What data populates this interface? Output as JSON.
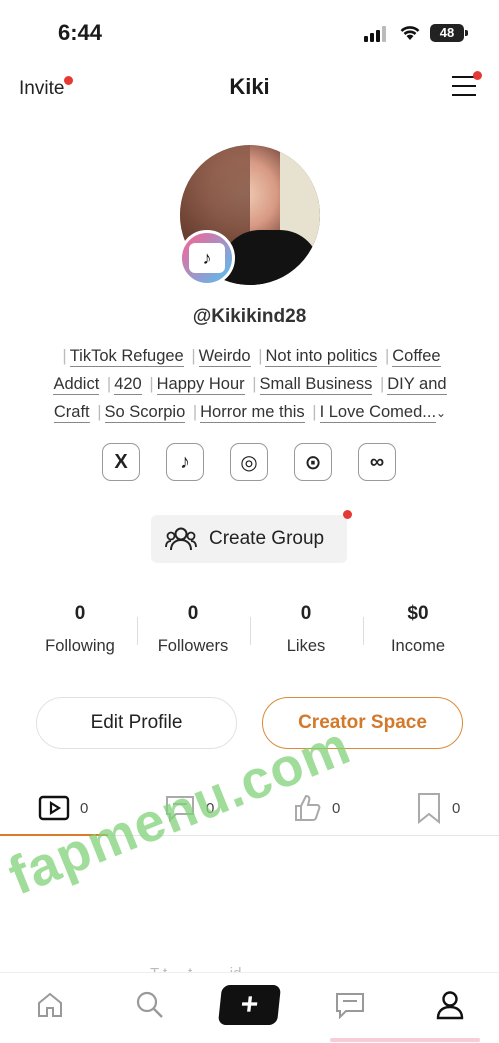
{
  "status_bar": {
    "time": "6:44",
    "battery": "48"
  },
  "header": {
    "invite_label": "Invite",
    "title": "Kiki"
  },
  "profile": {
    "handle": "@Kikikind28",
    "tags": [
      "TikTok Refugee",
      "Weirdo",
      "Not into politics",
      "Coffee Addict",
      "420",
      "Happy Hour",
      "Small Business",
      "DIY and Craft",
      "So Scorpio",
      "Horror me this",
      "I Love Comed..."
    ]
  },
  "socials": [
    {
      "icon": "x-icon",
      "glyph": "X"
    },
    {
      "icon": "tiktok-icon",
      "glyph": "♪"
    },
    {
      "icon": "instagram-icon",
      "glyph": "◎"
    },
    {
      "icon": "onlyfans-icon",
      "glyph": "⊙"
    },
    {
      "icon": "link-icon",
      "glyph": "∞"
    }
  ],
  "create_group": {
    "label": "Create Group"
  },
  "stats": [
    {
      "value": "0",
      "label": "Following"
    },
    {
      "value": "0",
      "label": "Followers"
    },
    {
      "value": "0",
      "label": "Likes"
    },
    {
      "value": "$0",
      "label": "Income"
    }
  ],
  "buttons": {
    "edit_profile": "Edit Profile",
    "creator_space": "Creator Space"
  },
  "content_tabs": [
    {
      "icon": "video-icon",
      "count": "0"
    },
    {
      "icon": "comment-icon",
      "count": "0"
    },
    {
      "icon": "thumbs-up-icon",
      "count": "0"
    },
    {
      "icon": "bookmark-icon",
      "count": "0"
    }
  ],
  "watermark": "fapmenu.com",
  "faded_text": "T  t  ...  t  ...  ...  id",
  "colors": {
    "accent": "#d97a2c",
    "notification_dot": "#e53935"
  }
}
